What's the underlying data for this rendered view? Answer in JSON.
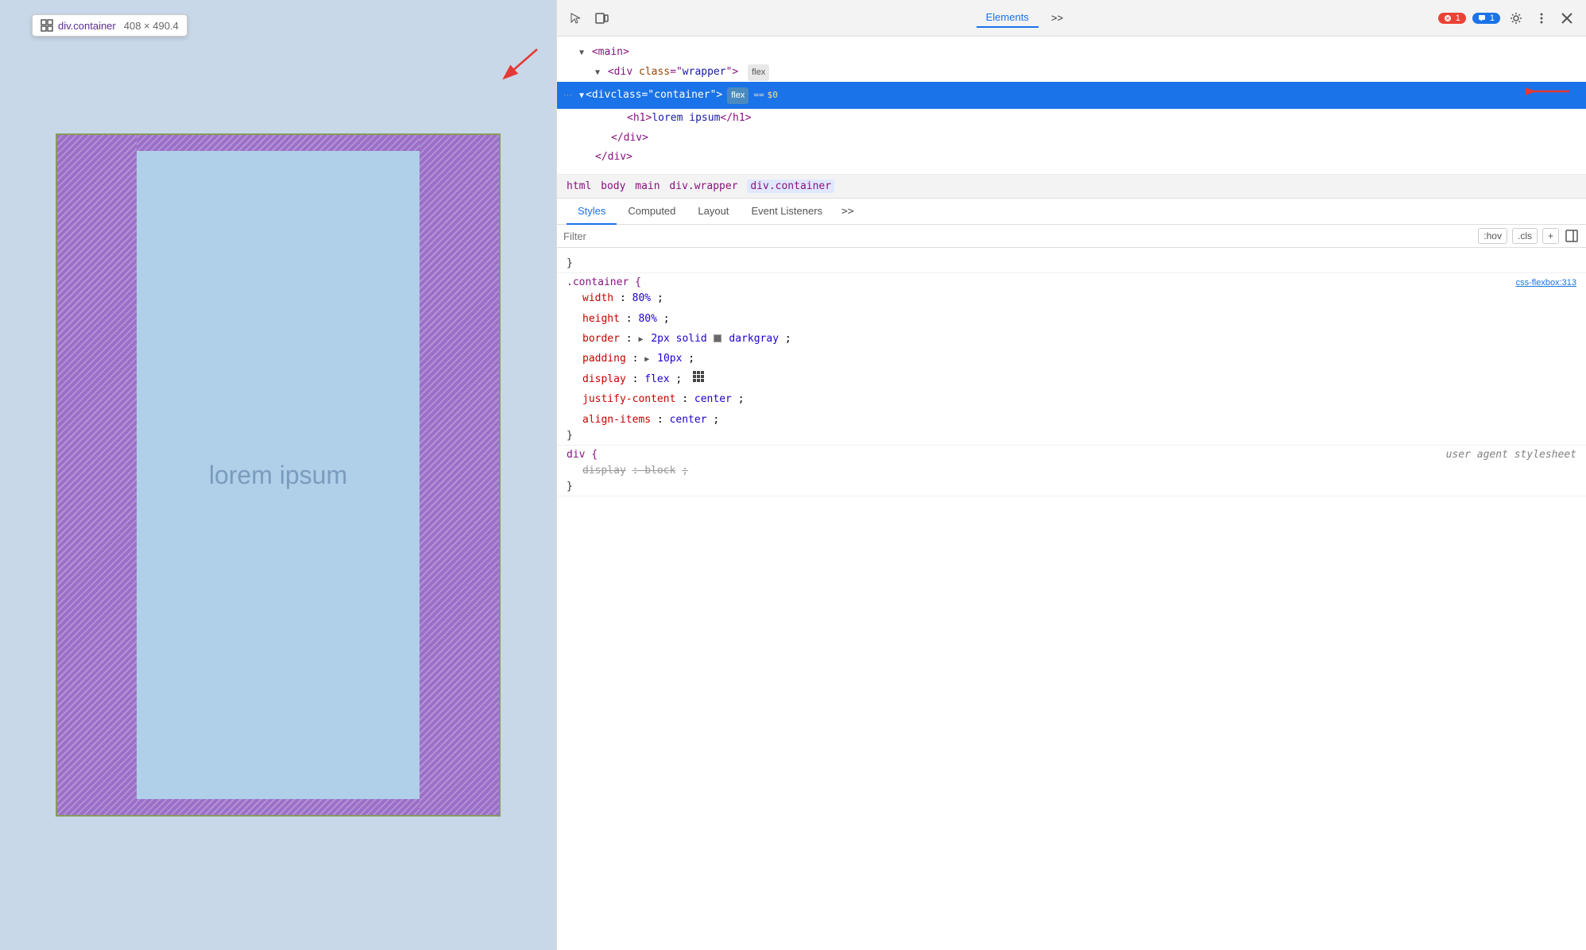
{
  "browser": {
    "tooltip": {
      "tag": "div.container",
      "size": "408 × 490.4"
    },
    "preview_text": "lorem ipsum"
  },
  "devtools": {
    "toolbar": {
      "tabs": [
        "Elements",
        ">>"
      ],
      "elements_label": "Elements",
      "more_label": ">>",
      "error_count": "1",
      "comment_count": "1"
    },
    "dom": {
      "lines": [
        {
          "indent": 0,
          "content": "▼<main>"
        },
        {
          "indent": 1,
          "content": "▼<div class=\"wrapper\">",
          "badge": "flex"
        },
        {
          "indent": 2,
          "content": "▼<div class=\"container\">",
          "badge": "flex",
          "selected": true,
          "dollar": true
        },
        {
          "indent": 3,
          "content": "<h1>lorem ipsum</h1>"
        },
        {
          "indent": 3,
          "content": "</div>"
        },
        {
          "indent": 2,
          "content": "</div>"
        }
      ]
    },
    "breadcrumb": [
      {
        "label": "html"
      },
      {
        "label": "body"
      },
      {
        "label": "main"
      },
      {
        "label": "div.wrapper"
      },
      {
        "label": "div.container",
        "active": true
      }
    ],
    "panel_tabs": [
      "Styles",
      "Computed",
      "Layout",
      "Event Listeners",
      ">>"
    ],
    "filter": {
      "placeholder": "Filter",
      "hov_label": ":hov",
      "cls_label": ".cls"
    },
    "styles": [
      {
        "selector": ".container {",
        "source": "css-flexbox:313",
        "properties": [
          {
            "prop": "width",
            "val": "80%",
            "strikethrough": false
          },
          {
            "prop": "height",
            "val": "80%",
            "strikethrough": false
          },
          {
            "prop": "border",
            "val": "▶ 2px solid ▪darkgray",
            "strikethrough": false,
            "has_swatch": true,
            "has_expand": true
          },
          {
            "prop": "padding",
            "val": "▶ 10px",
            "strikethrough": false,
            "has_expand": true
          },
          {
            "prop": "display",
            "val": "flex",
            "strikethrough": false,
            "has_flex_icon": true
          },
          {
            "prop": "justify-content",
            "val": "center",
            "strikethrough": false
          },
          {
            "prop": "align-items",
            "val": "center",
            "strikethrough": false
          }
        ]
      },
      {
        "selector": "div {",
        "source": "user agent stylesheet",
        "source_italic": true,
        "properties": [
          {
            "prop": "display",
            "val": "block",
            "strikethrough": true
          }
        ]
      }
    ]
  }
}
